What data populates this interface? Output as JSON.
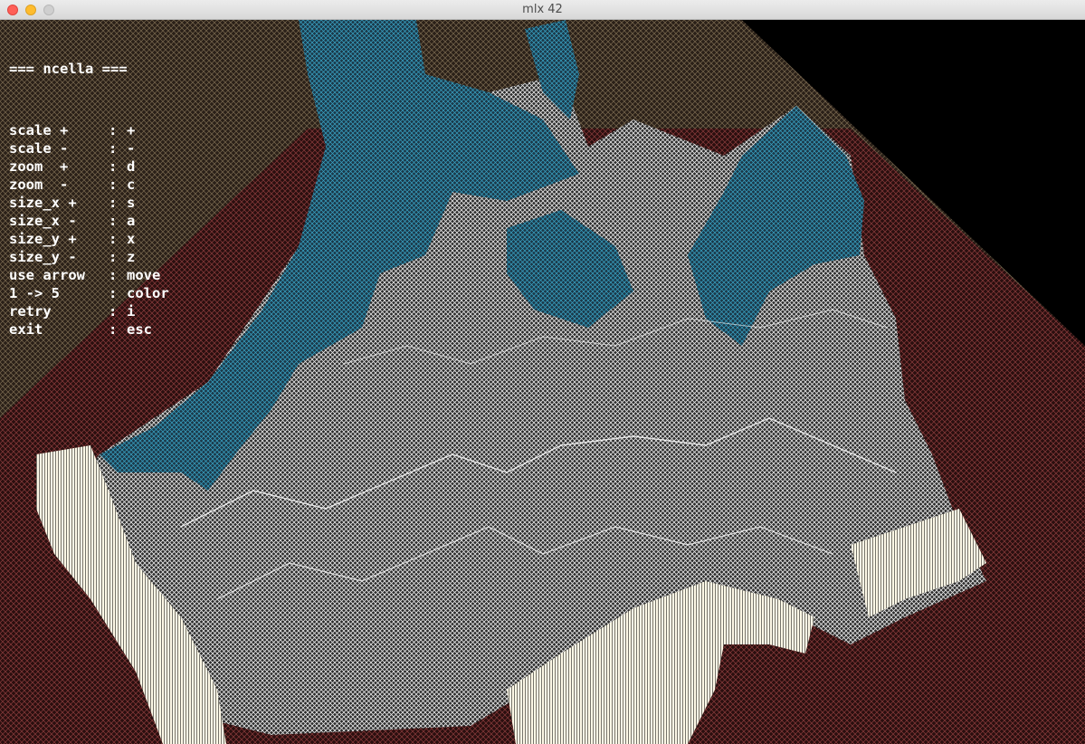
{
  "window": {
    "title": "mlx 42"
  },
  "help": {
    "title": "=== ncella ===",
    "rows": [
      {
        "key": "scale +",
        "value": "+"
      },
      {
        "key": "scale -",
        "value": "-"
      },
      {
        "key": "zoom  +",
        "value": "d"
      },
      {
        "key": "zoom  -",
        "value": "c"
      },
      {
        "key": "size_x +",
        "value": "s"
      },
      {
        "key": "size_x -",
        "value": "a"
      },
      {
        "key": "size_y +",
        "value": "x"
      },
      {
        "key": "size_y -",
        "value": "z"
      },
      {
        "key": "use arrow",
        "value": "move"
      },
      {
        "key": "1 -> 5",
        "value": "color"
      },
      {
        "key": "retry",
        "value": "i"
      },
      {
        "key": "exit",
        "value": "esc"
      }
    ],
    "separator": ":"
  },
  "colors": {
    "background": "#000000",
    "plane_left": "#2a2018",
    "plane_left_mesh": "#7a6a50",
    "plane_right": "#2a0f0f",
    "plane_right_mesh": "#8a3c3c",
    "terrain_dark": "#1b3848",
    "terrain_dark_mesh": "#3aa6c8",
    "terrain_light_mesh": "#ffffff",
    "cliff": "#fdf8e6",
    "text": "#ffffff"
  }
}
